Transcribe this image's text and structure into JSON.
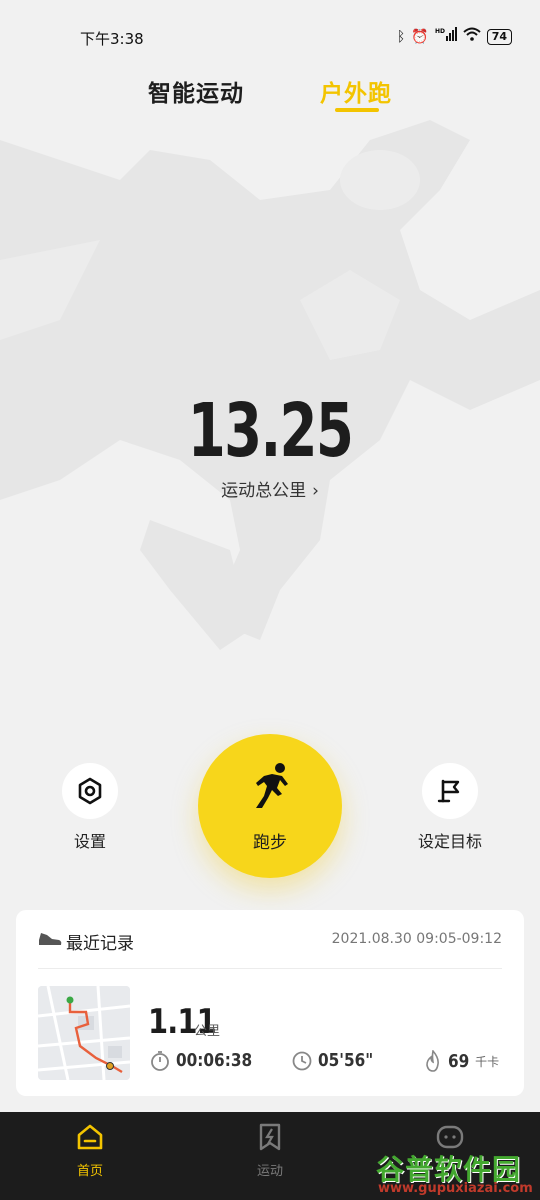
{
  "status_bar": {
    "time": "下午3:38",
    "battery": "74",
    "network": "HD"
  },
  "tabs": [
    {
      "label": "智能运动",
      "active": false
    },
    {
      "label": "户外跑",
      "active": true
    }
  ],
  "summary": {
    "total_distance": "13.25",
    "total_label": "运动总公里",
    "chevron": "›"
  },
  "actions": {
    "settings_label": "设置",
    "run_label": "跑步",
    "goal_label": "设定目标"
  },
  "recent": {
    "title": "最近记录",
    "datetime": "2021.08.30  09:05-09:12",
    "distance": "1.11",
    "distance_unit": "公里",
    "duration": "00:06:38",
    "pace": "05'56\"",
    "calories": "69",
    "calories_unit": "千卡"
  },
  "bottom_nav": [
    {
      "label": "首页",
      "icon": "home-icon",
      "active": true
    },
    {
      "label": "运动",
      "icon": "sport-icon",
      "active": false
    },
    {
      "label": "",
      "icon": "profile-icon",
      "active": false
    }
  ],
  "watermark": {
    "text": "谷普软件园",
    "url": "www.gupuxiazai.com"
  },
  "colors": {
    "accent": "#f3c400",
    "run_button": "#f7d61b",
    "background": "#f1f1f1",
    "nav_bg": "#1c1c1c"
  }
}
